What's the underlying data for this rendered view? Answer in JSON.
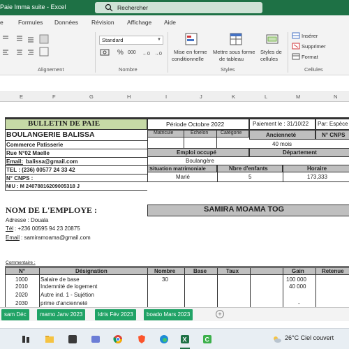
{
  "window": {
    "title": "Paie Imma suite  -  Excel"
  },
  "search": {
    "placeholder": "Rechercher"
  },
  "ribbon": {
    "tabs": [
      "e",
      "Formules",
      "Données",
      "Révision",
      "Affichage",
      "Aide"
    ],
    "number_format": "Standard",
    "number_symbols": {
      "percent": "%",
      "thousands": "000"
    },
    "groups": {
      "alignment": "Alignement",
      "number": "Nombre",
      "styles": "Styles",
      "cells": "Cellules"
    },
    "buttons": {
      "conditional_format_1": "Mise en forme",
      "conditional_format_2": "conditionnelle",
      "table_format_1": "Mettre sous forme",
      "table_format_2": "de tableau",
      "cell_styles_1": "Styles de",
      "cell_styles_2": "cellules",
      "insert": "Insérer",
      "delete": "Supprimer",
      "format": "Format"
    }
  },
  "columns": [
    "E",
    "F",
    "G",
    "H",
    "I",
    "J",
    "K",
    "L",
    "M",
    "N"
  ],
  "payslip": {
    "title": "BULLETIN DE PAIE",
    "period": "Période Octobre 2022",
    "payment": "Paiement le : 31/10/22",
    "payment_mode": "Par: Espèce",
    "company": "BOULANGERIE BALISSA",
    "activity": "Commerce Patisserie",
    "address": "Rue N°02 Maelle",
    "email_label": "Email:",
    "email": "balissa@gmail.com",
    "tel": "TEL : (236) 00577 24 33 42",
    "cnps": "N° CNPS :",
    "niu": "NIU : M 24078816209005318 J",
    "headers": {
      "matricule": "Matricule",
      "echelon": "Echelon",
      "categorie": "Catégorie",
      "anciennete": "Ancienneté",
      "ncnps": "N° CNPS",
      "emploi": "Emploi occupé",
      "departement": "Département",
      "situation": "Situation matrimoniale",
      "enfants": "Nbre d'enfants",
      "horaire": "Horaire"
    },
    "values": {
      "anciennete": "40 mois",
      "emploi": "Boulangère",
      "situation": "Marié",
      "enfants": "5",
      "horaire": "173,333"
    },
    "employee_label": "NOM DE L'EMPLOYE :",
    "employee_name": "SAMIRA MOAMA TOG",
    "employee_address": "Adresse : Douala",
    "employee_tel_label": "Tél",
    "employee_tel": ": +236 00595 94 23 20875",
    "employee_email_label": "Email",
    "employee_email": ": samiramoama@gmail.com",
    "comment": "Commentaire :",
    "table_headers": [
      "N°",
      "Désignation",
      "Nombre",
      "Base",
      "Taux",
      "Gain",
      "Retenue"
    ],
    "rows": [
      {
        "n": "1000",
        "designation": "Salaire de base",
        "nombre": "30",
        "gain": "100 000"
      },
      {
        "n": "2010",
        "designation": "Indemnité de logement",
        "nombre": "",
        "gain": "40 000"
      },
      {
        "n": "2020",
        "designation": "Autre ind. 1 - Sujétion",
        "nombre": "",
        "gain": ""
      },
      {
        "n": "2030",
        "designation": "prime d'ancienneté",
        "nombre": "",
        "gain": "-"
      }
    ]
  },
  "sheets": [
    "sam Déc",
    "mamo Janv 2023",
    "Idris Fév 2023",
    "boado Mars 2023"
  ],
  "taskbar": {
    "weather": "26°C  Ciel couvert"
  },
  "colors": {
    "excel_green": "#1e7145",
    "tab_green": "#21a366",
    "title_bg": "#c6d9a6",
    "header_gray": "#bfbfbf"
  }
}
